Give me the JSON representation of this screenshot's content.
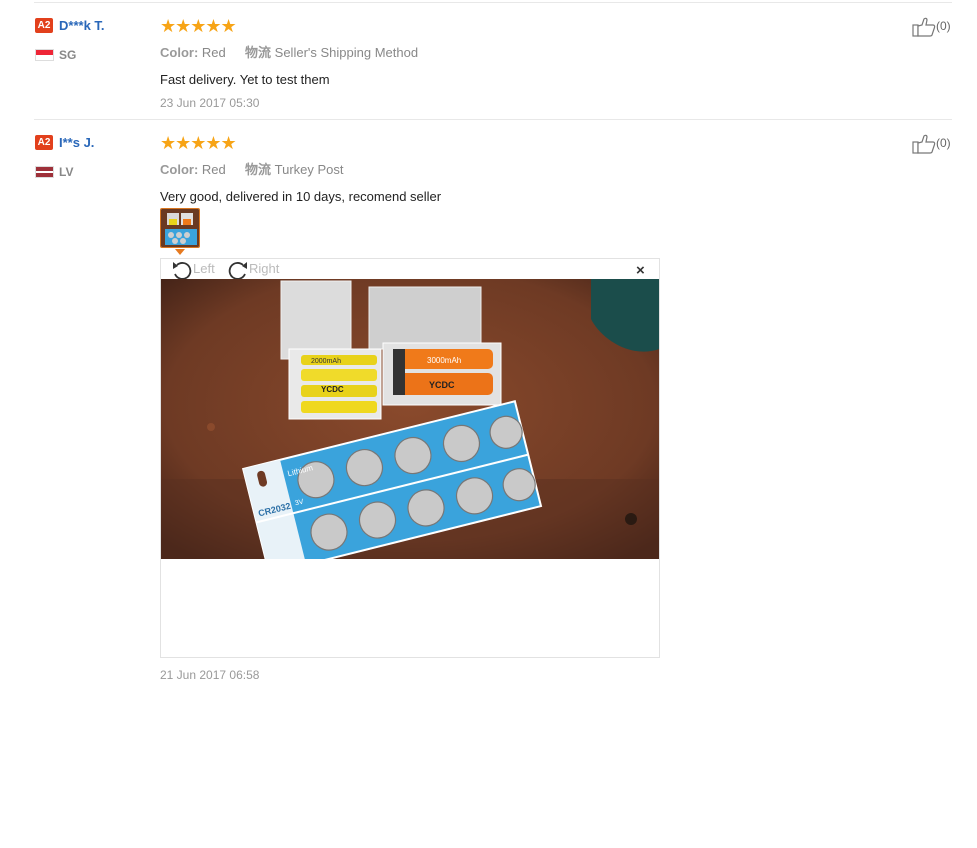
{
  "reviews": [
    {
      "level": "A2",
      "name": "D***k T.",
      "country": "SG",
      "stars": "★★★★★",
      "color_label": "Color:",
      "color_value": "Red",
      "shipping_label": "物流",
      "shipping_value": "Seller's Shipping Method",
      "feedback": "Fast delivery. Yet to test them",
      "date": "23 Jun 2017 05:30",
      "likes": "(0)"
    },
    {
      "level": "A2",
      "name": "I**s J.",
      "country": "LV",
      "stars": "★★★★★",
      "color_label": "Color:",
      "color_value": "Red",
      "shipping_label": "物流",
      "shipping_value": "Turkey Post",
      "feedback": "Very good, delivered in 10 days, recomend seller",
      "date": "21 Jun 2017 06:58",
      "likes": "(0)"
    }
  ],
  "viewer": {
    "rotate_left": "Left",
    "rotate_right": "Right",
    "close": "×"
  },
  "photo_labels": {
    "brand": "YCDC",
    "aa_cap": "2000mAh",
    "cr_cap": "3000mAh",
    "coin_model": "CR2032",
    "coin_type": "Lithium",
    "coin_volt": "3V"
  },
  "colors": {
    "accent_star": "#f7a416",
    "name_link": "#2967b9",
    "badge": "#e2401c"
  }
}
